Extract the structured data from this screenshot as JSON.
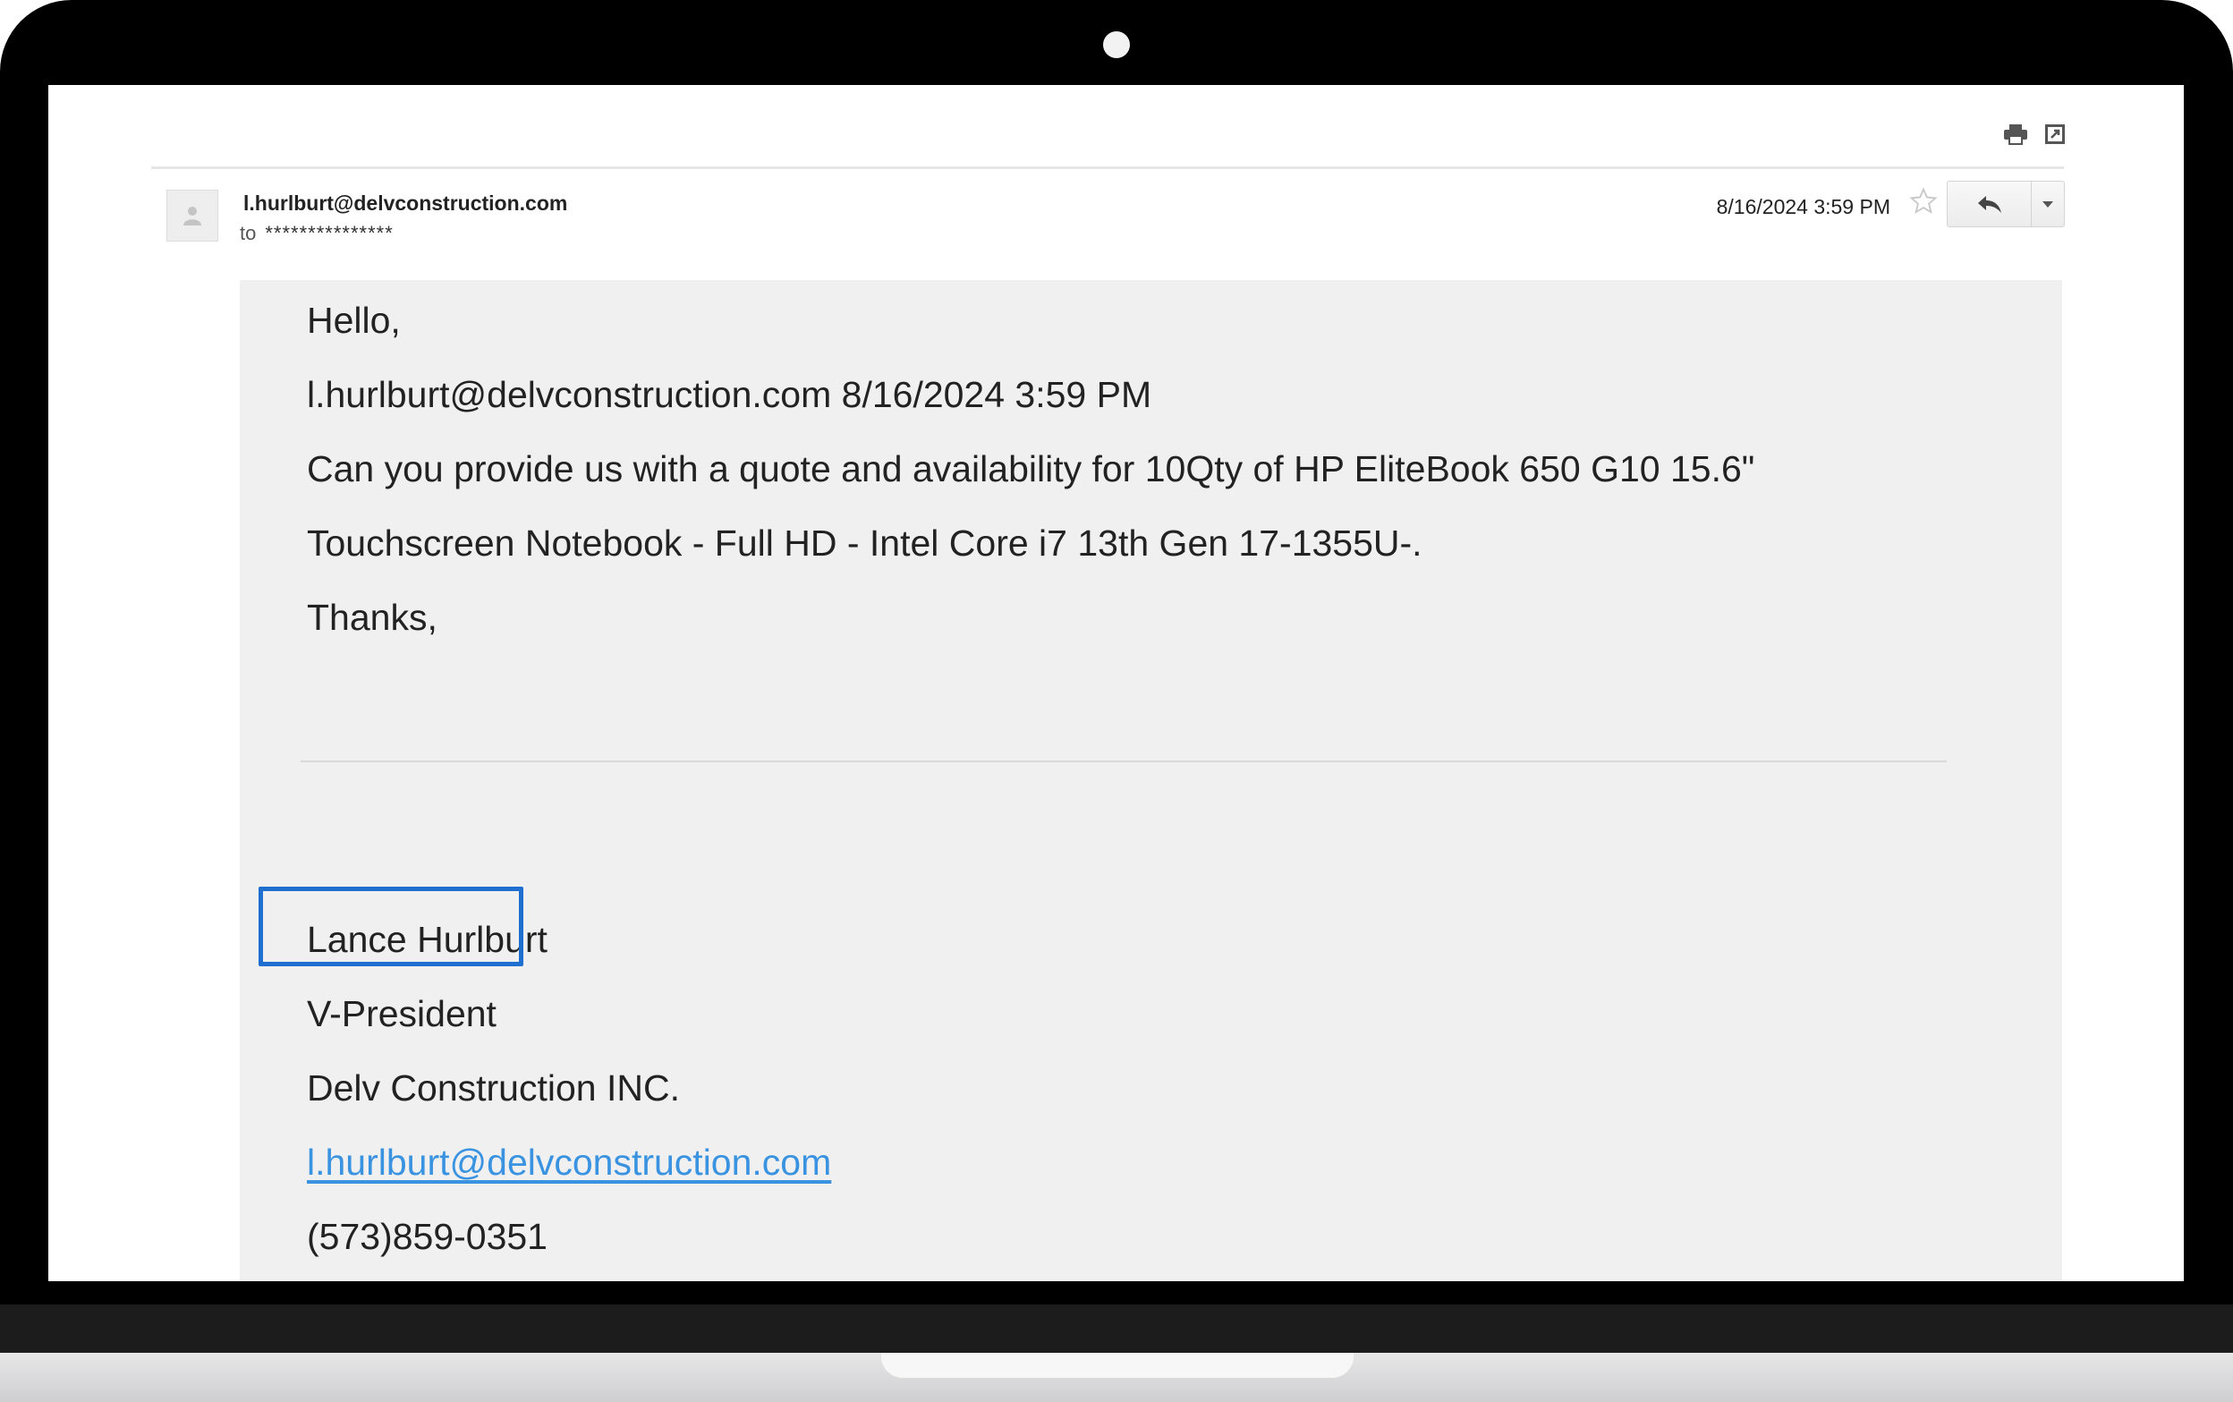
{
  "toolbar": {
    "print_icon": "printer-icon",
    "popout_icon": "open-in-new-window-icon"
  },
  "header": {
    "sender": "l.hurlburt@delvconstruction.com",
    "to_label": "to",
    "to_masked": "***************",
    "date": "8/16/2024 3:59 PM",
    "star_icon": "star-icon",
    "reply_icon": "reply-icon",
    "more_icon": "caret-down-icon"
  },
  "body": {
    "greeting": "Hello,",
    "quoted_meta": "l.hurlburt@delvconstruction.com 8/16/2024 3:59 PM",
    "request_line1": "Can you provide us with a quote and availability for 10Qty of HP EliteBook 650 G10 15.6\"",
    "request_line2": "Touchscreen Notebook - Full HD - Intel Core i7 13th Gen 17-1355U-.",
    "closing": "Thanks,"
  },
  "signature": {
    "name": "Lance Hurlburt",
    "title": "V-President",
    "company": "Delv Construction INC.",
    "email": "l.hurlburt@delvconstruction.com",
    "phone": "(573)859-0351"
  },
  "colors": {
    "highlight_border": "#1f6fd1",
    "link": "#3a93e0",
    "body_background": "#f0f0f0"
  }
}
